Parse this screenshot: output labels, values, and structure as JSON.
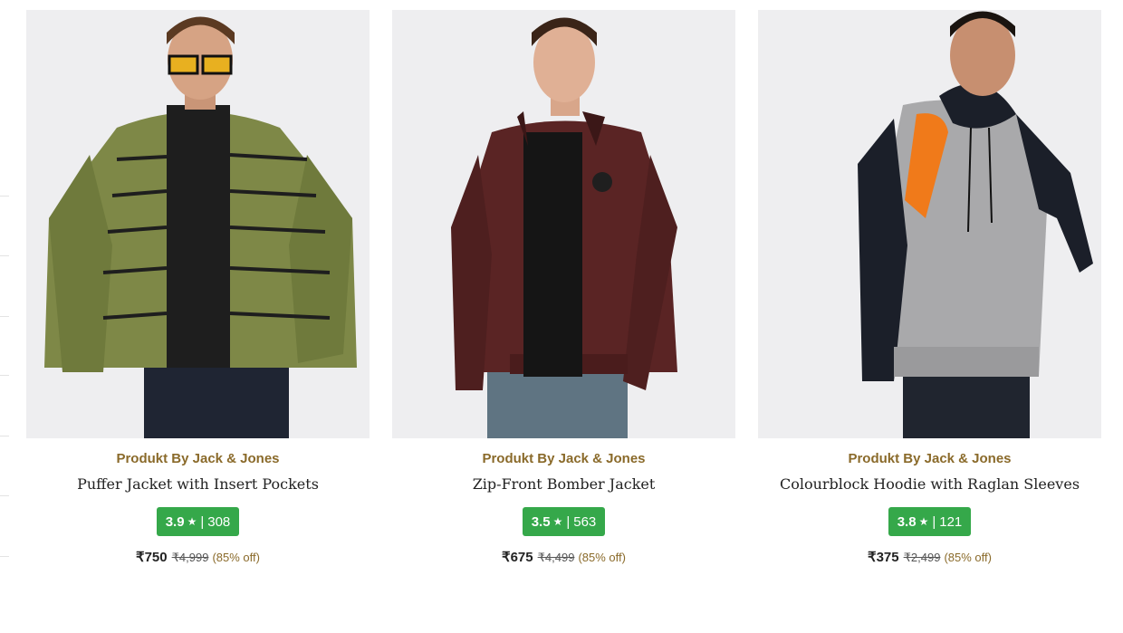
{
  "products": [
    {
      "brand": "Produkt By Jack & Jones",
      "name": "Puffer Jacket with Insert Pockets",
      "rating": "3.9",
      "rating_count": "308",
      "price": "₹750",
      "mrp": "₹4,999",
      "discount": "(85% off)",
      "garment_color": "#7e8847",
      "accent_color": "#1e1e1e",
      "image": "olive-puffer-jacket"
    },
    {
      "brand": "Produkt By Jack & Jones",
      "name": "Zip-Front Bomber Jacket",
      "rating": "3.5",
      "rating_count": "563",
      "price": "₹675",
      "mrp": "₹4,499",
      "discount": "(85% off)",
      "garment_color": "#5a2424",
      "accent_color": "#1a1a1a",
      "image": "maroon-bomber-jacket"
    },
    {
      "brand": "Produkt By Jack & Jones",
      "name": "Colourblock Hoodie with Raglan Sleeves",
      "rating": "3.8",
      "rating_count": "121",
      "price": "₹375",
      "mrp": "₹2,499",
      "discount": "(85% off)",
      "garment_color": "#a9a9ab",
      "accent_color": "#f07a1a",
      "image": "grey-colourblock-hoodie"
    }
  ],
  "icons": {
    "rating_star": "★",
    "separator": "|"
  },
  "colors": {
    "rating_badge": "#35a84a",
    "brand_text": "#8a6a2a"
  }
}
